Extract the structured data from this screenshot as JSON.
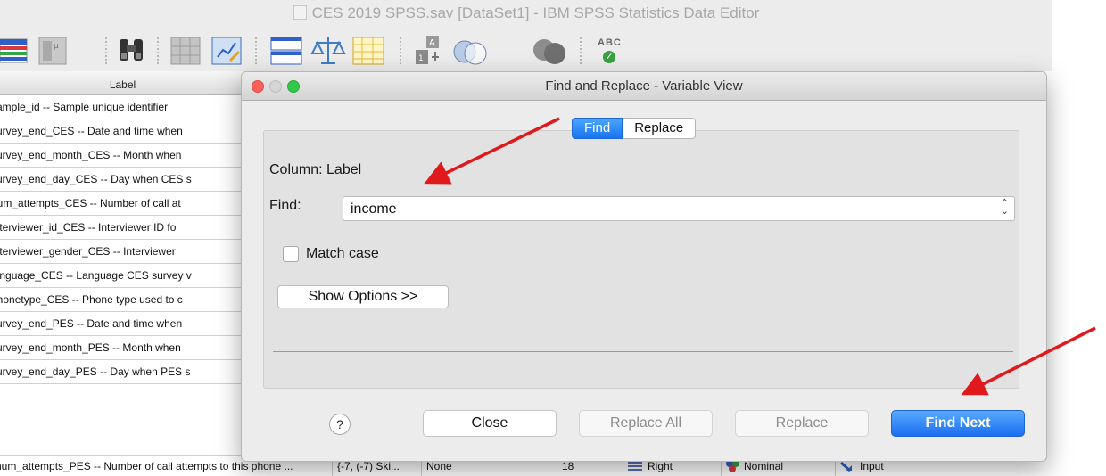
{
  "app": {
    "window_title": "CES 2019 SPSS.sav [DataSet1] - IBM SPSS Statistics Data Editor",
    "toolbar_icons": [
      "dataset-grid-icon",
      "variable-view-icon",
      "binoculars-find-icon",
      "table-icon",
      "chart-builder-icon",
      "split-file-icon",
      "weight-cases-icon",
      "select-cases-icon",
      "value-labels-icon",
      "use-sets-icon",
      "show-all-icon",
      "spell-check-icon"
    ],
    "spell_check_text": "ABC",
    "grid": {
      "header": "Label",
      "rows": [
        "sample_id -- Sample unique identifier",
        "survey_end_CES -- Date and time when",
        "survey_end_month_CES -- Month when",
        "survey_end_day_CES -- Day when CES s",
        "num_attempts_CES -- Number of call at",
        "interviewer_id_CES -- Interviewer ID fo",
        "interviewer_gender_CES -- Interviewer",
        "language_CES -- Language CES survey v",
        "phonetype_CES -- Phone type used to c",
        "survey_end_PES -- Date and time when",
        "survey_end_month_PES -- Month when",
        "survey_end_day_PES -- Day when PES s"
      ],
      "last_row": {
        "label": "num_attempts_PES -- Number of call attempts to this phone ...",
        "values": "{-7, (-7) Ski...",
        "missing": "None",
        "columns": "18",
        "align": "Right",
        "measure": "Nominal",
        "role": "Input"
      }
    }
  },
  "dialog": {
    "title": "Find and Replace - Variable View",
    "tabs": [
      {
        "label": "Find",
        "active": true
      },
      {
        "label": "Replace",
        "active": false
      }
    ],
    "column_line": "Column:  Label",
    "find_label": "Find:",
    "find_value": "income",
    "match_case_label": "Match case",
    "match_case_checked": false,
    "options_button": "Show Options >>",
    "help_button": "?",
    "buttons": {
      "close": "Close",
      "replace_all": "Replace All",
      "replace": "Replace",
      "find_next": "Find Next"
    }
  },
  "colors": {
    "accent_blue": "#1b6ff0",
    "annotation_arrow": "#e0191c",
    "traffic_close": "#fc605b",
    "traffic_min": "#d5d5d5",
    "traffic_max": "#34c84a"
  }
}
